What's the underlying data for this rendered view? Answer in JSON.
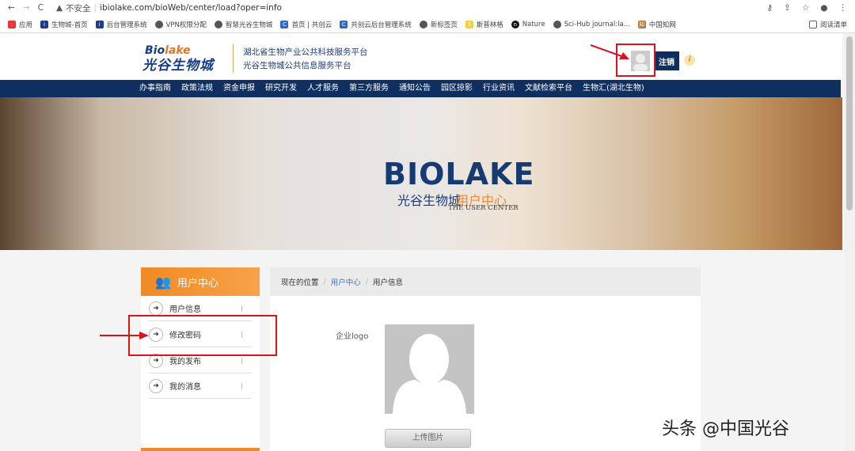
{
  "browser": {
    "security": "不安全",
    "url": "ibiolake.com/bioWeb/center/load?oper=info",
    "bookmarks": [
      "应用",
      "生物城-首页",
      "后台管理系统",
      "VPN权限分配",
      "智慧光谷生物城",
      "首页 | 共创云",
      "共创云后台管理系统",
      "新标签页",
      "斯普林格",
      "Nature",
      "Sci-Hub journal:la...",
      "中国知网"
    ],
    "reading_list": "阅读清单"
  },
  "header": {
    "logo_en_a": "Bio",
    "logo_en_b": "lake",
    "logo_cn": "光谷生物城",
    "subtitle1": "湖北省生物产业公共科技服务平台",
    "subtitle2": "光谷生物城公共信息服务平台",
    "logout": "注销",
    "info": "i"
  },
  "nav": [
    "办事指南",
    "政策法规",
    "资金申报",
    "研究开发",
    "人才服务",
    "第三方服务",
    "通知公告",
    "园区掠影",
    "行业资讯",
    "文献检索平台",
    "生物汇(湖北生物)"
  ],
  "banner": {
    "title": "BIOLAKE",
    "cn1": "光谷生物城",
    "cn2": "用户中心",
    "en": "THE USER CENTER"
  },
  "sidebar": {
    "title": "用户中心",
    "items": [
      "用户信息",
      "修改密码",
      "我的发布",
      "我的消息"
    ]
  },
  "breadcrumb": {
    "prefix": "现在的位置",
    "level1": "用户中心",
    "level2": "用户信息"
  },
  "profile": {
    "logo_label": "企业logo",
    "upload": "上传图片"
  },
  "watermark": "头条 @中国光谷"
}
